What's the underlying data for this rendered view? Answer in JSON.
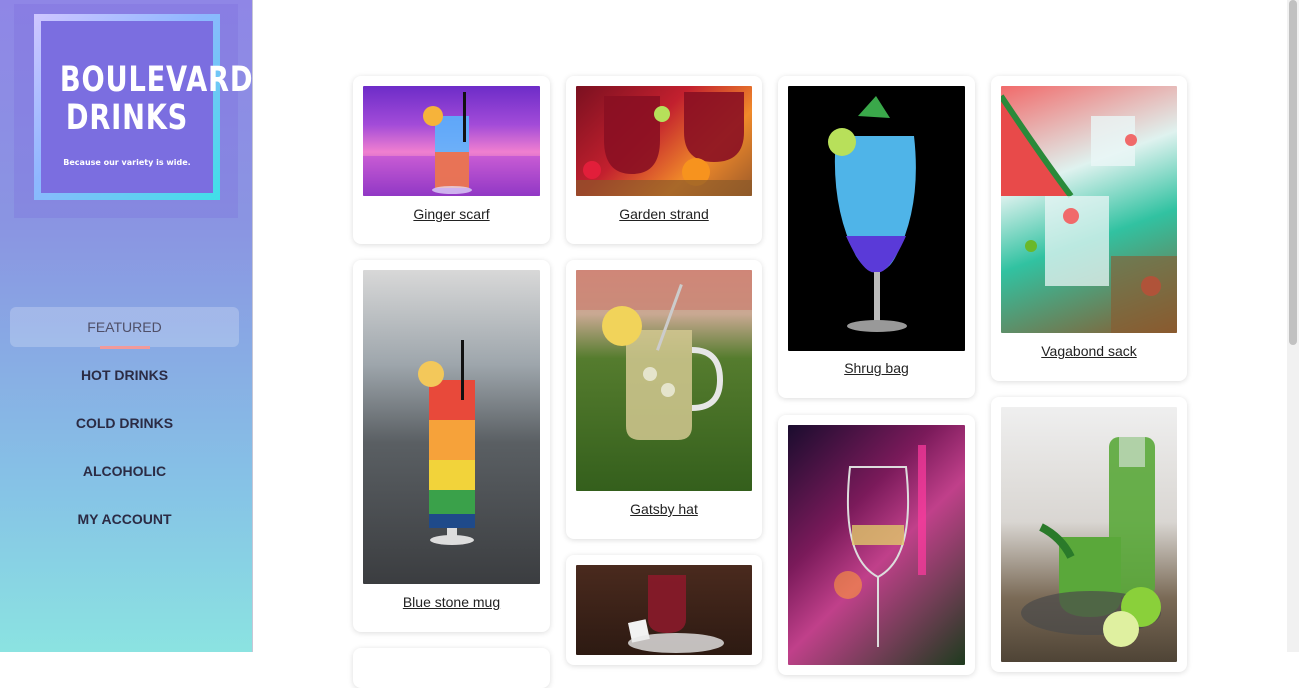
{
  "brand": {
    "title_line1": "BOULEVARD",
    "title_line2": "DRINKS",
    "tagline": "Because our variety is wide."
  },
  "nav": [
    {
      "label": "FEATURED",
      "active": true
    },
    {
      "label": "HOT DRINKS",
      "active": false
    },
    {
      "label": "COLD DRINKS",
      "active": false
    },
    {
      "label": "ALCOHOLIC",
      "active": false
    },
    {
      "label": "MY ACCOUNT",
      "active": false
    }
  ],
  "products": [
    {
      "name": "Ginger scarf"
    },
    {
      "name": "Garden strand"
    },
    {
      "name": "Shrug bag"
    },
    {
      "name": "Vagabond sack"
    },
    {
      "name": "Blue stone mug"
    },
    {
      "name": "Gatsby hat"
    }
  ],
  "colors": {
    "sidebar_top": "#8f86e6",
    "sidebar_bottom": "#8be3e1",
    "active_underline": "#f29a9a"
  }
}
